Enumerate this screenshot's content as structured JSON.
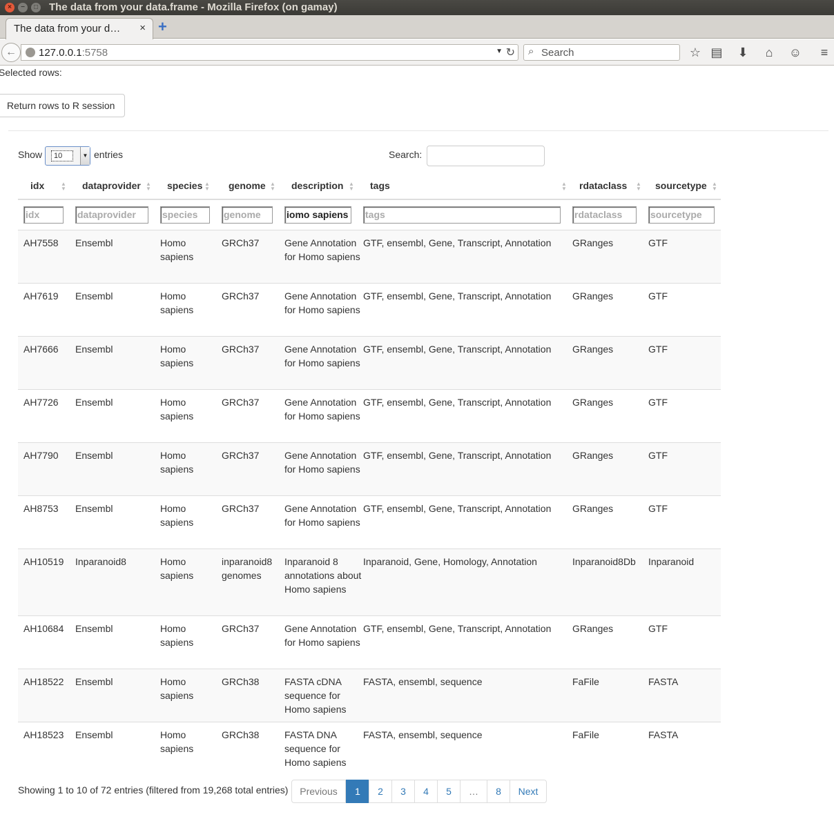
{
  "window": {
    "title": "The data from your data.frame - Mozilla Firefox (on gamay)",
    "close_glyph": "×",
    "min_glyph": "−",
    "max_glyph": "□"
  },
  "tab": {
    "label": "The data from your d…",
    "close_glyph": "×",
    "new_tab_glyph": "+"
  },
  "nav": {
    "url_host": "127.0.0.1",
    "url_port": ":5758",
    "search_placeholder": "Search",
    "icons": [
      "star-icon",
      "reading-list-icon",
      "download-icon",
      "home-icon",
      "chat-icon",
      "menu-icon"
    ]
  },
  "page": {
    "selected_rows_label": "Selected rows:",
    "return_button": "Return rows to R session",
    "show_label": "Show",
    "page_length": "10",
    "entries_label": "entries",
    "search_label": "Search:",
    "search_value": ""
  },
  "table": {
    "columns": [
      "idx",
      "dataprovider",
      "species",
      "genome",
      "description",
      "tags",
      "rdataclass",
      "sourcetype"
    ],
    "filters": {
      "idx": "",
      "dataprovider": "",
      "species": "",
      "genome": "",
      "description": "iomo sapiens",
      "tags": "",
      "rdataclass": "",
      "sourcetype": ""
    },
    "filter_placeholders": [
      "idx",
      "dataprovider",
      "species",
      "genome",
      "description",
      "tags",
      "rdataclass",
      "sourcetype"
    ],
    "rows": [
      {
        "idx": "AH7558",
        "dataprovider": "Ensembl",
        "species": "Homo sapiens",
        "genome": "GRCh37",
        "description": "Gene Annotation for Homo sapiens",
        "tags": "GTF, ensembl, Gene, Transcript, Annotation",
        "rdataclass": "GRanges",
        "sourcetype": "GTF"
      },
      {
        "idx": "AH7619",
        "dataprovider": "Ensembl",
        "species": "Homo sapiens",
        "genome": "GRCh37",
        "description": "Gene Annotation for Homo sapiens",
        "tags": "GTF, ensembl, Gene, Transcript, Annotation",
        "rdataclass": "GRanges",
        "sourcetype": "GTF"
      },
      {
        "idx": "AH7666",
        "dataprovider": "Ensembl",
        "species": "Homo sapiens",
        "genome": "GRCh37",
        "description": "Gene Annotation for Homo sapiens",
        "tags": "GTF, ensembl, Gene, Transcript, Annotation",
        "rdataclass": "GRanges",
        "sourcetype": "GTF"
      },
      {
        "idx": "AH7726",
        "dataprovider": "Ensembl",
        "species": "Homo sapiens",
        "genome": "GRCh37",
        "description": "Gene Annotation for Homo sapiens",
        "tags": "GTF, ensembl, Gene, Transcript, Annotation",
        "rdataclass": "GRanges",
        "sourcetype": "GTF"
      },
      {
        "idx": "AH7790",
        "dataprovider": "Ensembl",
        "species": "Homo sapiens",
        "genome": "GRCh37",
        "description": "Gene Annotation for Homo sapiens",
        "tags": "GTF, ensembl, Gene, Transcript, Annotation",
        "rdataclass": "GRanges",
        "sourcetype": "GTF"
      },
      {
        "idx": "AH8753",
        "dataprovider": "Ensembl",
        "species": "Homo sapiens",
        "genome": "GRCh37",
        "description": "Gene Annotation for Homo sapiens",
        "tags": "GTF, ensembl, Gene, Transcript, Annotation",
        "rdataclass": "GRanges",
        "sourcetype": "GTF"
      },
      {
        "idx": "AH10519",
        "dataprovider": "Inparanoid8",
        "species": "Homo sapiens",
        "genome": "inparanoid8 genomes",
        "description": "Inparanoid 8 annotations about Homo sapiens",
        "tags": "Inparanoid, Gene, Homology, Annotation",
        "rdataclass": "Inparanoid8Db",
        "sourcetype": "Inparanoid"
      },
      {
        "idx": "AH10684",
        "dataprovider": "Ensembl",
        "species": "Homo sapiens",
        "genome": "GRCh37",
        "description": "Gene Annotation for Homo sapiens",
        "tags": "GTF, ensembl, Gene, Transcript, Annotation",
        "rdataclass": "GRanges",
        "sourcetype": "GTF"
      },
      {
        "idx": "AH18522",
        "dataprovider": "Ensembl",
        "species": "Homo sapiens",
        "genome": "GRCh38",
        "description": "FASTA cDNA sequence for Homo sapiens",
        "tags": "FASTA, ensembl, sequence",
        "rdataclass": "FaFile",
        "sourcetype": "FASTA"
      },
      {
        "idx": "AH18523",
        "dataprovider": "Ensembl",
        "species": "Homo sapiens",
        "genome": "GRCh38",
        "description": "FASTA DNA sequence for Homo sapiens",
        "tags": "FASTA, ensembl, sequence",
        "rdataclass": "FaFile",
        "sourcetype": "FASTA"
      }
    ]
  },
  "footer": {
    "info": "Showing 1 to 10 of 72 entries (filtered from 19,268 total entries)",
    "pagination": [
      "Previous",
      "1",
      "2",
      "3",
      "4",
      "5",
      "…",
      "8",
      "Next"
    ],
    "active_page": "1"
  },
  "colors": {
    "link": "#337ab7",
    "active_page_bg": "#337ab7",
    "stripe": "#f9f9f9"
  }
}
